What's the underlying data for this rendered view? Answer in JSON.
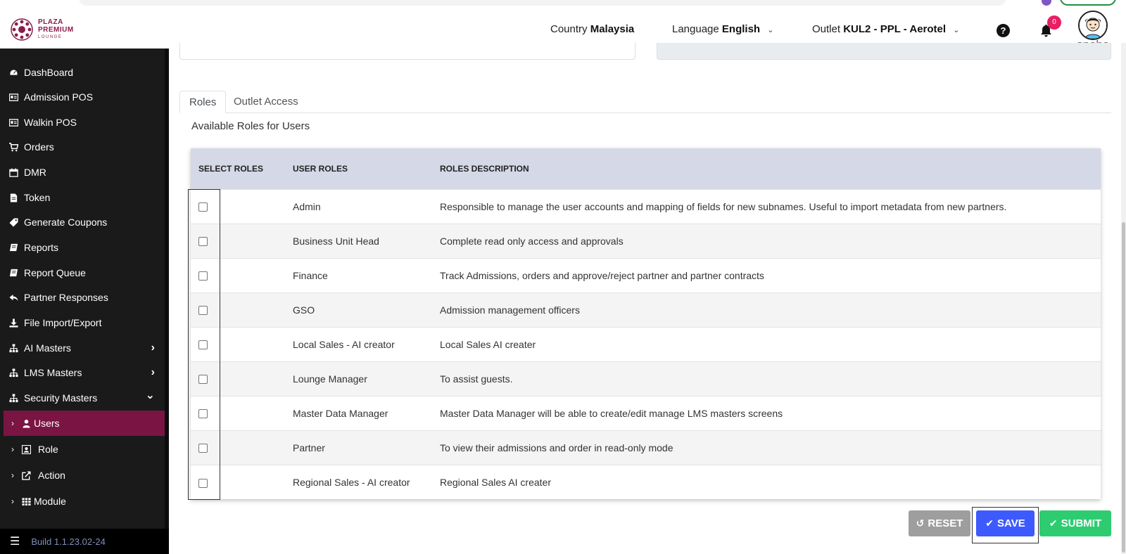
{
  "colors": {
    "brand": "#7a1543",
    "save": "#3d5afe",
    "submit": "#2ecc71",
    "reset": "#9e9e9e",
    "table_header": "#d5d8e6"
  },
  "brand": {
    "line1": "PLAZA",
    "line2": "PREMIUM",
    "line3": "LOUNGE"
  },
  "header": {
    "country_label": "Country",
    "country_value": "Malaysia",
    "language_label": "Language",
    "language_value": "English",
    "outlet_label": "Outlet",
    "outlet_value": "KUL2 - PPL - Aerotel",
    "notification_count": "0",
    "username": "sneha"
  },
  "sidebar": {
    "items": [
      {
        "label": "DashBoard",
        "icon": "dashboard-icon"
      },
      {
        "label": "Admission POS",
        "icon": "id-card-icon"
      },
      {
        "label": "Walkin POS",
        "icon": "id-card-icon"
      },
      {
        "label": "Orders",
        "icon": "cart-icon"
      },
      {
        "label": "DMR",
        "icon": "calendar-icon"
      },
      {
        "label": "Token",
        "icon": "file-icon"
      },
      {
        "label": "Generate Coupons",
        "icon": "tag-icon"
      },
      {
        "label": "Reports",
        "icon": "book-icon"
      },
      {
        "label": "Report Queue",
        "icon": "book-icon"
      },
      {
        "label": "Partner Responses",
        "icon": "reply-icon"
      },
      {
        "label": "File Import/Export",
        "icon": "download-icon"
      },
      {
        "label": "AI Masters",
        "icon": "sitemap-icon",
        "arrow": "›"
      },
      {
        "label": "LMS Masters",
        "icon": "sitemap-icon",
        "arrow": "›"
      },
      {
        "label": "Security Masters",
        "icon": "sitemap-icon",
        "arrow": "⌄"
      }
    ],
    "sub_items": [
      {
        "label": "Users",
        "icon": "user-icon"
      },
      {
        "label": "Role",
        "icon": "role-icon"
      },
      {
        "label": "Action",
        "icon": "external-icon"
      },
      {
        "label": "Module",
        "icon": "grid-icon"
      }
    ],
    "build": "Build 1.1.23.02-24"
  },
  "tabs": [
    "Roles",
    "Outlet Access"
  ],
  "available_roles_title": "Available Roles for Users",
  "table": {
    "headers": [
      "SELECT ROLES",
      "USER ROLES",
      "ROLES DESCRIPTION"
    ],
    "rows": [
      {
        "role": "Admin",
        "desc": "Responsible to manage the user accounts and mapping of fields for new subnames. Useful to import metadata from new partners."
      },
      {
        "role": "Business Unit Head",
        "desc": "Complete read only access and approvals"
      },
      {
        "role": "Finance",
        "desc": "Track Admissions, orders and approve/reject partner and partner contracts"
      },
      {
        "role": "GSO",
        "desc": "Admission management officers"
      },
      {
        "role": "Local Sales - AI creator",
        "desc": "Local Sales AI creater"
      },
      {
        "role": "Lounge Manager",
        "desc": "To assist guests."
      },
      {
        "role": "Master Data Manager",
        "desc": "Master Data Manager will be able to create/edit manage LMS masters screens"
      },
      {
        "role": "Partner",
        "desc": "To view their admissions and order in read-only mode"
      },
      {
        "role": "Regional Sales - AI creator",
        "desc": "Regional Sales AI creater"
      }
    ]
  },
  "buttons": {
    "reset": "RESET",
    "save": "SAVE",
    "submit": "SUBMIT"
  }
}
